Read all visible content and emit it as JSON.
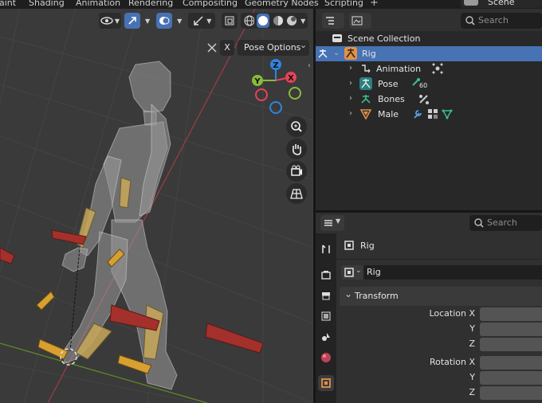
{
  "top_menu": {
    "workspace_tabs": [
      "aint",
      "Shading",
      "Animation",
      "Rendering",
      "Compositing",
      "Geometry Nodes",
      "Scripting"
    ],
    "add_tab_glyph": "+",
    "scene_name": "Scene"
  },
  "viewport": {
    "pose_options_label": "Pose Options",
    "pose_options_caret": "⌄",
    "x_axis_toggle": "X",
    "gizmo": {
      "y": "Y",
      "x": "X",
      "z": "Z"
    },
    "navigation": [
      "zoom-icon",
      "hand-pan-icon",
      "camera-icon",
      "grid-icon"
    ]
  },
  "outliner": {
    "search_placeholder": "Search",
    "items": [
      {
        "label": "Scene Collection",
        "icon": "collection-icon",
        "depth": 0
      },
      {
        "label": "Rig",
        "icon": "armature-icon",
        "depth": 0,
        "selected": true
      },
      {
        "label": "Animation",
        "icon": "action-icon",
        "depth": 1
      },
      {
        "label": "Pose",
        "icon": "pose-icon",
        "depth": 1,
        "badge": "60"
      },
      {
        "label": "Bones",
        "icon": "bones-icon",
        "depth": 1
      },
      {
        "label": "Male",
        "icon": "mesh-icon",
        "depth": 1
      }
    ]
  },
  "properties": {
    "search_placeholder": "Search",
    "object_name": "Rig",
    "datablock_name": "Rig",
    "panel_title": "Transform",
    "location_label": "Location X",
    "rotation_label": "Rotation X",
    "axis_y": "Y",
    "axis_z": "Z"
  },
  "colors": {
    "accent": "#4772b3",
    "axis_x": "#e8425a",
    "axis_y": "#8bba3a",
    "axis_z": "#2f83e3",
    "bone_yellow": "#c8a85a",
    "bone_red": "#a4302c"
  }
}
